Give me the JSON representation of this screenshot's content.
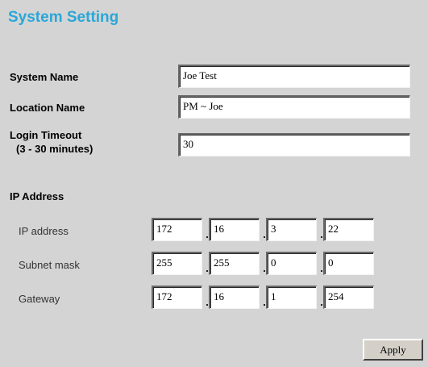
{
  "page": {
    "title": "System Setting"
  },
  "system_name": {
    "label": "System Name",
    "value": "Joe Test"
  },
  "location_name": {
    "label": "Location Name",
    "value": "PM ~ Joe"
  },
  "login_timeout": {
    "label_line1": "Login Timeout",
    "label_line2": "(3 - 30 minutes)",
    "value": "30"
  },
  "ip_section": {
    "heading": "IP Address",
    "ip_address": {
      "label": "IP address",
      "octets": [
        "172",
        "16",
        "3",
        "22"
      ]
    },
    "subnet_mask": {
      "label": "Subnet mask",
      "octets": [
        "255",
        "255",
        "0",
        "0"
      ]
    },
    "gateway": {
      "label": "Gateway",
      "octets": [
        "172",
        "16",
        "1",
        "254"
      ]
    }
  },
  "actions": {
    "apply_label": "Apply"
  }
}
